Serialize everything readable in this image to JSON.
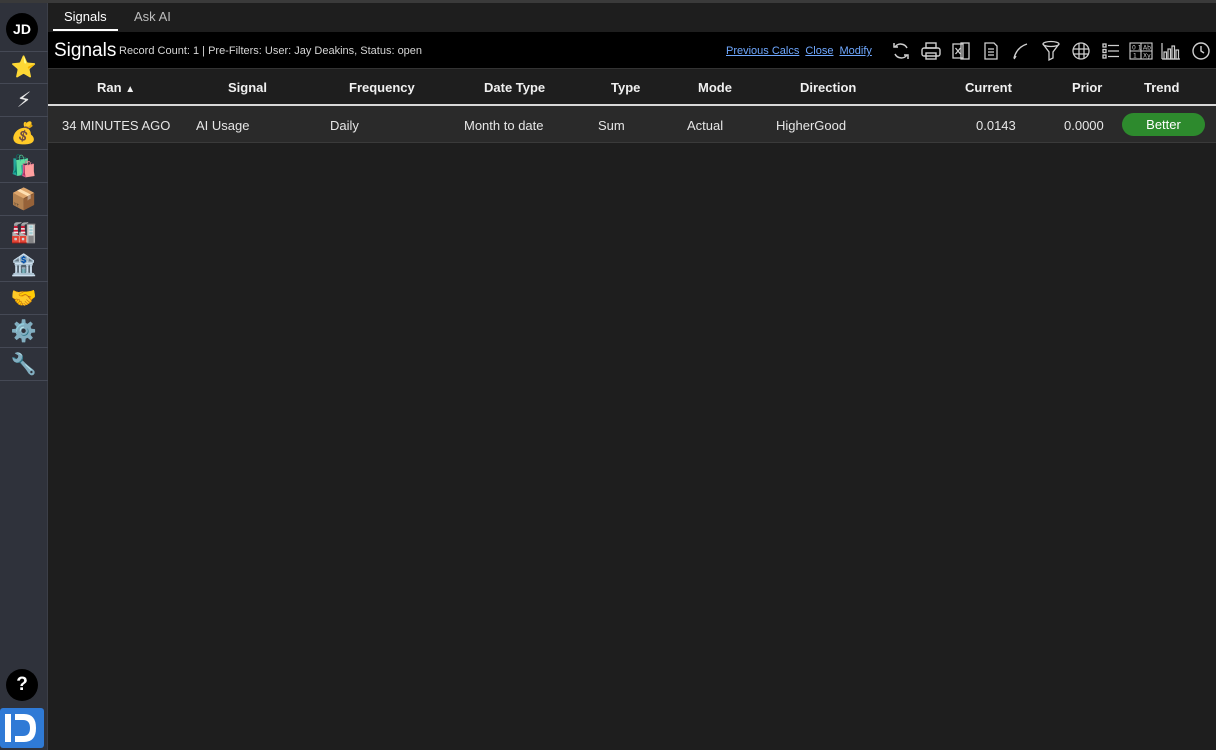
{
  "sidebar": {
    "avatar": "JD",
    "items": [
      {
        "name": "star-icon",
        "glyph": "⭐"
      },
      {
        "name": "lightning-icon",
        "glyph": "⚡"
      },
      {
        "name": "money-bag-icon",
        "glyph": "💰"
      },
      {
        "name": "shopping-bags-icon",
        "glyph": "🛍️"
      },
      {
        "name": "package-icon",
        "glyph": "📦"
      },
      {
        "name": "factory-icon",
        "glyph": "🏭"
      },
      {
        "name": "bank-icon",
        "glyph": "🏦"
      },
      {
        "name": "handshake-icon",
        "glyph": "🤝"
      },
      {
        "name": "gear-icon",
        "glyph": "⚙️"
      },
      {
        "name": "wrench-icon",
        "glyph": "🔧"
      }
    ],
    "help": "?"
  },
  "tabs": [
    {
      "label": "Signals",
      "active": true
    },
    {
      "label": "Ask AI",
      "active": false
    }
  ],
  "header": {
    "title": "Signals",
    "meta": "Record Count: 1 | Pre-Filters: User: Jay Deakins, Status: open",
    "links": [
      "Previous Calcs",
      "Close",
      "Modify"
    ]
  },
  "toolbar": [
    "refresh-icon",
    "print-icon",
    "excel-export-icon",
    "document-icon",
    "chart-line-icon",
    "filter-icon",
    "globe-grid-icon",
    "list-icon",
    "calculator-icon",
    "bar-chart-icon",
    "clock-icon"
  ],
  "table": {
    "columns": [
      "Ran",
      "Signal",
      "Frequency",
      "Date Type",
      "Type",
      "Mode",
      "Direction",
      "Current",
      "Prior",
      "Trend"
    ],
    "sort_indicator": "▲",
    "rows": [
      {
        "ran": "34 MINUTES AGO",
        "signal": "AI Usage",
        "frequency": "Daily",
        "date_type": "Month to date",
        "type": "Sum",
        "mode": "Actual",
        "direction": "HigherGood",
        "current": "0.0143",
        "prior": "0.0000",
        "trend": "Better"
      }
    ]
  },
  "colors": {
    "accent_link": "#6fa8ff",
    "trend_better": "#2d8a2d",
    "logo": "#2f7ad6"
  }
}
